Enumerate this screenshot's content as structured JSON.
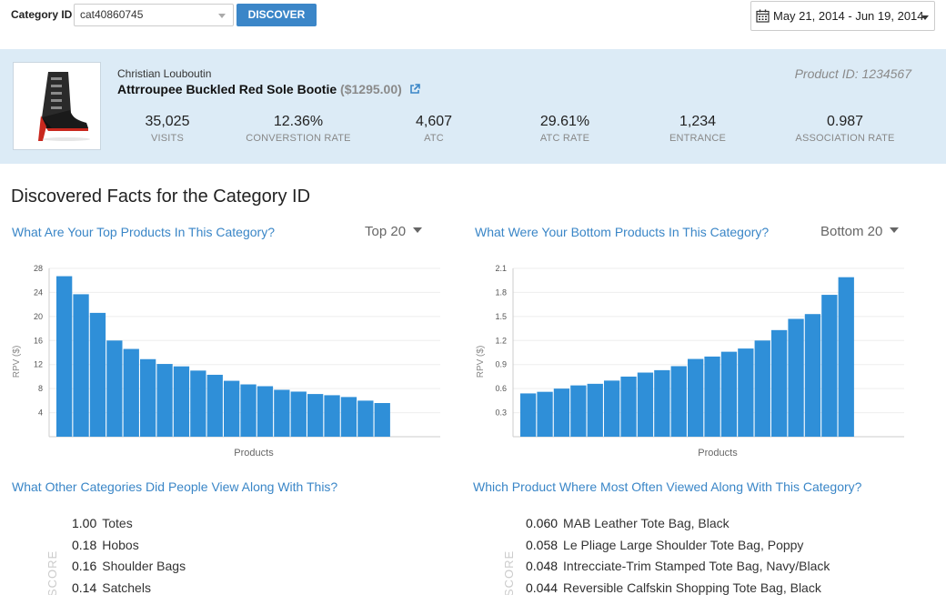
{
  "toolbar": {
    "category_label": "Category ID",
    "category_value": "cat40860745",
    "discover_label": "DISCOVER",
    "date_range": "May 21, 2014 - Jun 19, 2014"
  },
  "product": {
    "brand": "Christian Louboutin",
    "name": "Attrroupee Buckled Red Sole Bootie",
    "price": "($1295.00)",
    "product_id": "Product ID: 1234567",
    "stats": [
      {
        "value": "35,025",
        "label": "VISITS"
      },
      {
        "value": "12.36%",
        "label": "CONVERSTION RATE"
      },
      {
        "value": "4,607",
        "label": "ATC"
      },
      {
        "value": "29.61%",
        "label": "ATC RATE"
      },
      {
        "value": "1,234",
        "label": "ENTRANCE"
      },
      {
        "value": "0.987",
        "label": "ASSOCIATION RATE"
      }
    ]
  },
  "main": {
    "section_title": "Discovered Facts for the Category ID",
    "top_question": "What Are Your Top Products In This Category?",
    "top_select": "Top 20",
    "bottom_question": "What Were Your Bottom Products In This Category?",
    "bottom_select": "Bottom 20",
    "categories_question": "What Other Categories Did People View Along With This?",
    "products_question": "Which Product Where Most Often Viewed Along With This Category?",
    "score_axis_label": "SCORE",
    "categories": [
      {
        "score": "1.00",
        "label": "Totes"
      },
      {
        "score": "0.18",
        "label": "Hobos"
      },
      {
        "score": "0.16",
        "label": "Shoulder Bags"
      },
      {
        "score": "0.14",
        "label": "Satchels"
      }
    ],
    "products": [
      {
        "score": "0.060",
        "label": "MAB Leather Tote Bag, Black"
      },
      {
        "score": "0.058",
        "label": "Le Pliage Large Shoulder Tote Bag, Poppy"
      },
      {
        "score": "0.048",
        "label": "Intrecciate-Trim Stamped Tote Bag, Navy/Black"
      },
      {
        "score": "0.044",
        "label": "Reversible Calfskin Shopping Tote Bag, Black"
      }
    ]
  },
  "colors": {
    "accent": "#3a86c7",
    "bar": "#2f8fd8",
    "banner_bg": "#dcebf6"
  },
  "chart_data": [
    {
      "type": "bar",
      "xlabel": "Products",
      "ylabel": "RPV ($)",
      "ylim": [
        0,
        28
      ],
      "yticks": [
        4,
        8,
        12,
        16,
        20,
        24,
        28
      ],
      "values": [
        26.7,
        23.7,
        20.6,
        16.0,
        14.6,
        12.9,
        12.1,
        11.7,
        11.0,
        10.3,
        9.3,
        8.7,
        8.4,
        7.8,
        7.5,
        7.1,
        6.9,
        6.6,
        6.0,
        5.6
      ]
    },
    {
      "type": "bar",
      "xlabel": "Products",
      "ylabel": "RPV ($)",
      "ylim": [
        0,
        2.1
      ],
      "yticks": [
        0.3,
        0.6,
        0.9,
        1.2,
        1.5,
        1.8,
        2.1
      ],
      "values": [
        0.54,
        0.56,
        0.6,
        0.64,
        0.66,
        0.7,
        0.75,
        0.8,
        0.83,
        0.88,
        0.97,
        1.0,
        1.06,
        1.1,
        1.2,
        1.33,
        1.47,
        1.53,
        1.77,
        1.99
      ]
    }
  ]
}
